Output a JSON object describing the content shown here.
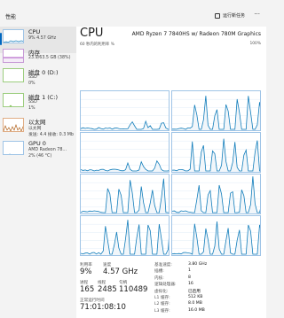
{
  "header": {
    "title": "性能",
    "run_task": "运行新任务",
    "more": "···"
  },
  "sidebar": [
    {
      "name": "CPU",
      "sub": "9% 4.57 GHz",
      "active": true,
      "color": "#117dbb"
    },
    {
      "name": "内存",
      "sub": "23.9/63.5 GB (38%)",
      "color": "#8b12ae"
    },
    {
      "name": "磁盘 0 (D:)",
      "sub": "SSD",
      "sub2": "0%",
      "color": "#4da60c"
    },
    {
      "name": "磁盘 1 (C:)",
      "sub": "SSD",
      "sub2": "1%",
      "color": "#4da60c"
    },
    {
      "name": "以太网",
      "sub": "以太网",
      "sub2": "发送: 4.4 接收: 0.3 Mb",
      "color": "#a74f01"
    },
    {
      "name": "GPU 0",
      "sub": "AMD Radeon 78...",
      "sub2": "2% (46 °C)",
      "color": "#117dbb"
    }
  ],
  "main": {
    "title": "CPU",
    "model": "AMD Ryzen 7 7840HS w/ Radeon 780M Graphics",
    "util_label": "60 秒内的利用率 %",
    "max_pct": "100%",
    "graph_count": 16
  },
  "stats": {
    "util_label": "利用率",
    "util_value": "9%",
    "speed_label": "速度",
    "speed_value": "4.57 GHz",
    "proc_label": "进程",
    "proc_value": "165",
    "thread_label": "线程",
    "thread_value": "2485",
    "handle_label": "句柄",
    "handle_value": "110489",
    "uptime_label": "正常运行时间",
    "uptime_value": "71:01:08:10"
  },
  "right_stats": [
    {
      "label": "基准速度:",
      "value": "3.80 GHz"
    },
    {
      "label": "插槽:",
      "value": "1"
    },
    {
      "label": "内核:",
      "value": "8"
    },
    {
      "label": "逻辑处理器:",
      "value": "16"
    },
    {
      "label": "虚拟化:",
      "value": "已启用"
    },
    {
      "label": "L1 缓存:",
      "value": "512 KB"
    },
    {
      "label": "L2 缓存:",
      "value": "8.0 MB"
    },
    {
      "label": "L3 缓存:",
      "value": "16.0 MB"
    }
  ],
  "colors": {
    "line": "#117dbb",
    "fill": "#f1f6fa",
    "border": "#9fc4e6",
    "grid": "#d9e8f5"
  }
}
